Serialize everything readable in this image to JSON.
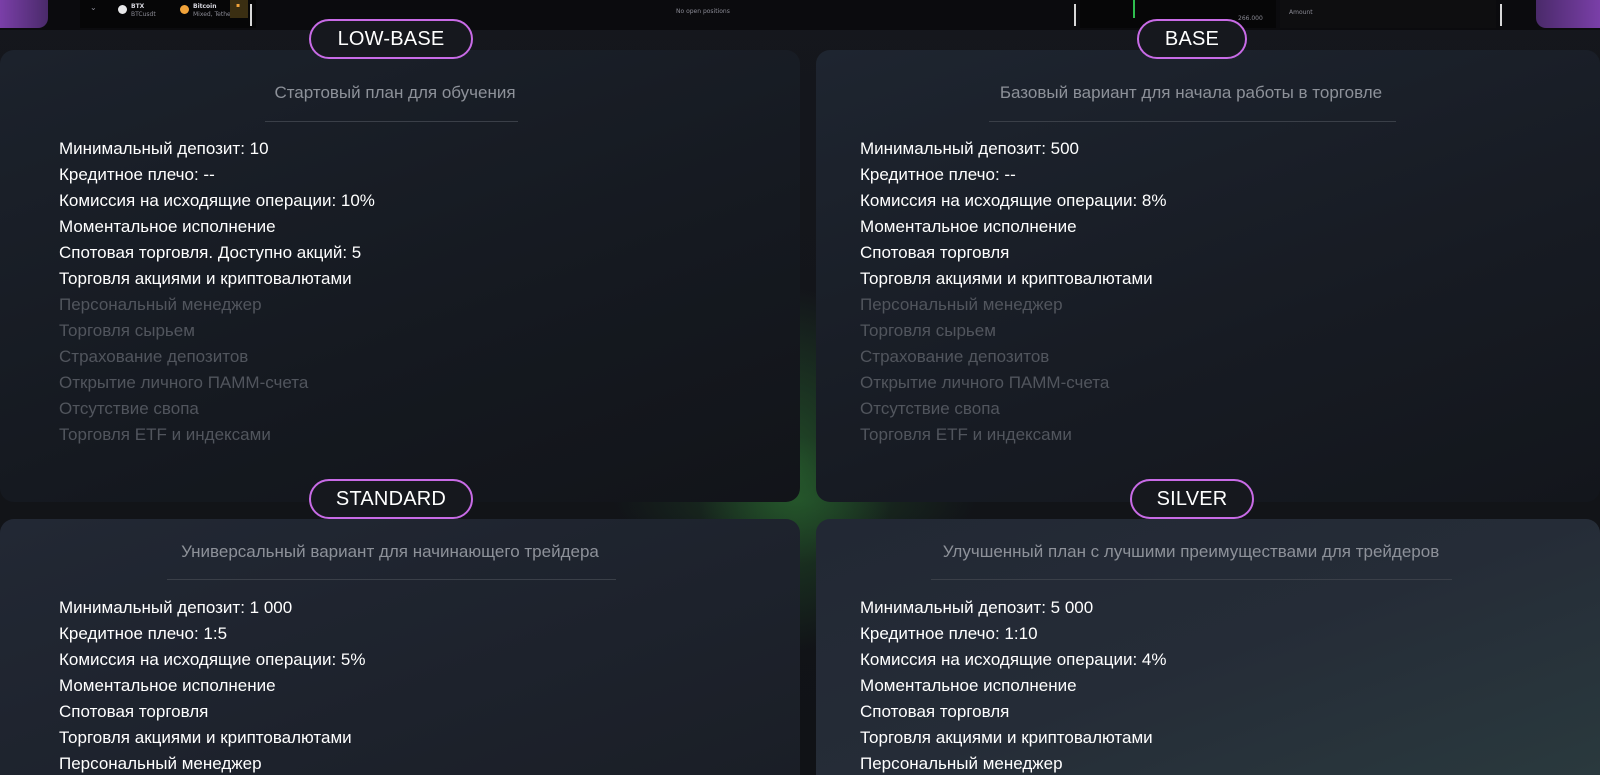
{
  "topbar": {
    "ticker": "BTX",
    "ticker_sub": "BTCusdt",
    "coin_name": "Bitcoin",
    "coin_sub": "Mixed, Tether",
    "center_text": "No open positions",
    "price": "266.000",
    "amount_label": "Amount"
  },
  "colors": {
    "accent": "#c86be6",
    "text_active": "#ffffff",
    "text_inactive": "#51555d",
    "subtitle": "#8d9199"
  },
  "plans": [
    {
      "name": "LOW-BASE",
      "subtitle": "Стартовый план для обучения",
      "features": [
        {
          "text": "Минимальный депозит: 10",
          "active": true
        },
        {
          "text": "Кредитное плечо: --",
          "active": true
        },
        {
          "text": "Комиссия на исходящие операции: 10%",
          "active": true
        },
        {
          "text": "Моментальное исполнение",
          "active": true
        },
        {
          "text": "Спотовая торговля. Доступно акций: 5",
          "active": true
        },
        {
          "text": "Торговля акциями и криптовалютами",
          "active": true
        },
        {
          "text": "Персональный менеджер",
          "active": false
        },
        {
          "text": "Торговля сырьем",
          "active": false
        },
        {
          "text": "Страхование депозитов",
          "active": false
        },
        {
          "text": "Открытие личного ПАММ-счета",
          "active": false
        },
        {
          "text": "Отсутствие свопа",
          "active": false
        },
        {
          "text": "Торговля ETF и индексами",
          "active": false
        }
      ]
    },
    {
      "name": "BASE",
      "subtitle": "Базовый вариант для начала работы в торговле",
      "features": [
        {
          "text": "Минимальный депозит: 500",
          "active": true
        },
        {
          "text": "Кредитное плечо: --",
          "active": true
        },
        {
          "text": "Комиссия на исходящие операции: 8%",
          "active": true
        },
        {
          "text": "Моментальное исполнение",
          "active": true
        },
        {
          "text": "Спотовая торговля",
          "active": true
        },
        {
          "text": "Торговля акциями и криптовалютами",
          "active": true
        },
        {
          "text": "Персональный менеджер",
          "active": false
        },
        {
          "text": "Торговля сырьем",
          "active": false
        },
        {
          "text": "Страхование депозитов",
          "active": false
        },
        {
          "text": "Открытие личного ПАММ-счета",
          "active": false
        },
        {
          "text": "Отсутствие свопа",
          "active": false
        },
        {
          "text": "Торговля ETF и индексами",
          "active": false
        }
      ]
    },
    {
      "name": "STANDARD",
      "subtitle": "Универсальный вариант для начинающего трейдера",
      "features": [
        {
          "text": "Минимальный депозит: 1 000",
          "active": true
        },
        {
          "text": "Кредитное плечо: 1:5",
          "active": true
        },
        {
          "text": "Комиссия на исходящие операции: 5%",
          "active": true
        },
        {
          "text": "Моментальное исполнение",
          "active": true
        },
        {
          "text": "Спотовая торговля",
          "active": true
        },
        {
          "text": "Торговля акциями и криптовалютами",
          "active": true
        },
        {
          "text": "Персональный менеджер",
          "active": true
        }
      ]
    },
    {
      "name": "SILVER",
      "subtitle": "Улучшенный план с лучшими преимуществами для трейдеров",
      "features": [
        {
          "text": "Минимальный депозит: 5 000",
          "active": true
        },
        {
          "text": "Кредитное плечо: 1:10",
          "active": true
        },
        {
          "text": "Комиссия на исходящие операции: 4%",
          "active": true
        },
        {
          "text": "Моментальное исполнение",
          "active": true
        },
        {
          "text": "Спотовая торговля",
          "active": true
        },
        {
          "text": "Торговля акциями и криптовалютами",
          "active": true
        },
        {
          "text": "Персональный менеджер",
          "active": true
        }
      ]
    }
  ]
}
